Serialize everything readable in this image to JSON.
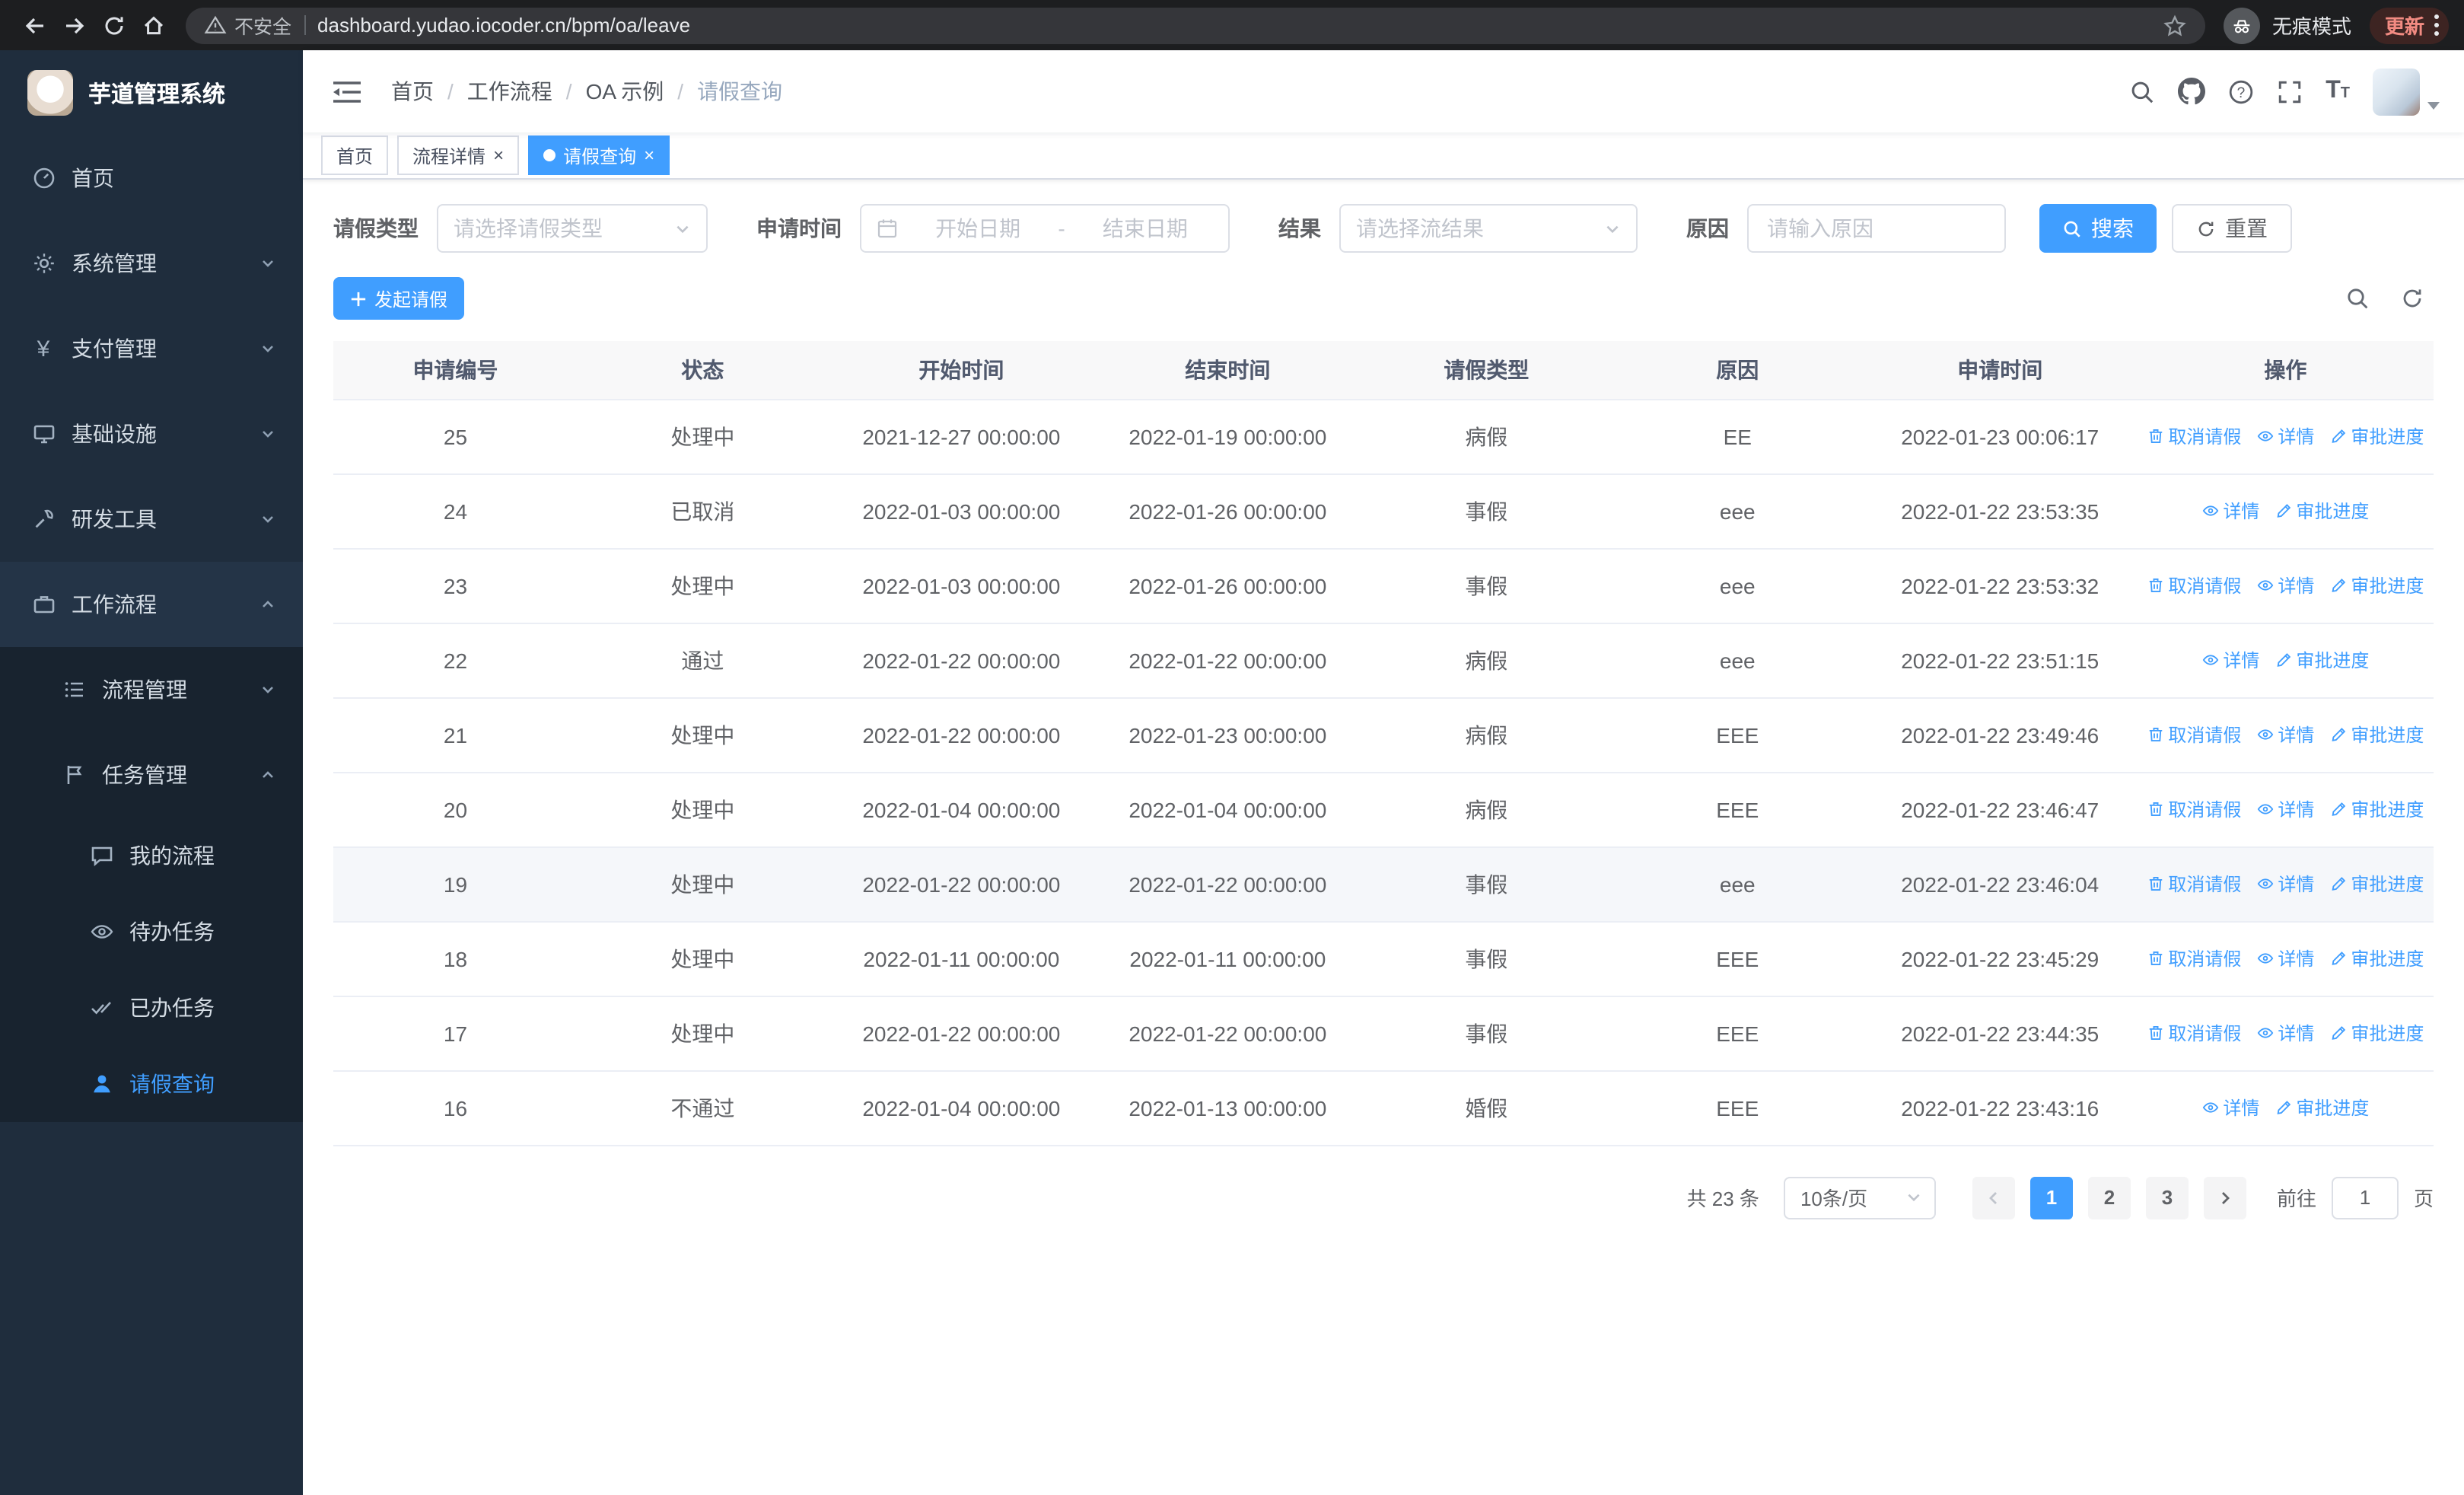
{
  "browser": {
    "security": "不安全",
    "url": "dashboard.yudao.iocoder.cn/bpm/oa/leave",
    "incognito": "无痕模式",
    "update": "更新"
  },
  "icons": {
    "yen": "¥",
    "close": "×",
    "question": "?",
    "t_big": "T",
    "t_small": "T"
  },
  "sidebar": {
    "title": "芋道管理系统",
    "menu": [
      {
        "label": "首页"
      },
      {
        "label": "系统管理"
      },
      {
        "label": "支付管理"
      },
      {
        "label": "基础设施"
      },
      {
        "label": "研发工具"
      },
      {
        "label": "工作流程"
      }
    ],
    "submenu": [
      {
        "label": "流程管理"
      },
      {
        "label": "任务管理"
      }
    ],
    "tasks": [
      {
        "label": "我的流程"
      },
      {
        "label": "待办任务"
      },
      {
        "label": "已办任务"
      },
      {
        "label": "请假查询"
      }
    ]
  },
  "header": {
    "breadcrumb": [
      "首页",
      "工作流程",
      "OA 示例",
      "请假查询"
    ],
    "breadcrumb_sep": "/"
  },
  "tabs": [
    {
      "label": "首页",
      "active": false,
      "closable": false
    },
    {
      "label": "流程详情",
      "active": false,
      "closable": true
    },
    {
      "label": "请假查询",
      "active": true,
      "closable": true
    }
  ],
  "filters": {
    "leave_type_label": "请假类型",
    "leave_type_placeholder": "请选择请假类型",
    "apply_time_label": "申请时间",
    "start_date_placeholder": "开始日期",
    "range_separator": "-",
    "end_date_placeholder": "结束日期",
    "result_label": "结果",
    "result_placeholder": "请选择流结果",
    "reason_label": "原因",
    "reason_placeholder": "请输入原因",
    "search_button": "搜索",
    "reset_button": "重置"
  },
  "toolbar": {
    "create_button": "发起请假"
  },
  "table": {
    "columns": [
      "申请编号",
      "状态",
      "开始时间",
      "结束时间",
      "请假类型",
      "原因",
      "申请时间",
      "操作"
    ],
    "op_labels": {
      "cancel": "取消请假",
      "detail": "详情",
      "progress": "审批进度"
    },
    "rows": [
      {
        "id": "25",
        "status": "处理中",
        "start": "2021-12-27 00:00:00",
        "end": "2022-01-19 00:00:00",
        "type": "病假",
        "reason": "EE",
        "applied": "2022-01-23 00:06:17",
        "ops": [
          "cancel",
          "detail",
          "progress"
        ],
        "hover": false
      },
      {
        "id": "24",
        "status": "已取消",
        "start": "2022-01-03 00:00:00",
        "end": "2022-01-26 00:00:00",
        "type": "事假",
        "reason": "eee",
        "applied": "2022-01-22 23:53:35",
        "ops": [
          "detail",
          "progress"
        ],
        "hover": false
      },
      {
        "id": "23",
        "status": "处理中",
        "start": "2022-01-03 00:00:00",
        "end": "2022-01-26 00:00:00",
        "type": "事假",
        "reason": "eee",
        "applied": "2022-01-22 23:53:32",
        "ops": [
          "cancel",
          "detail",
          "progress"
        ],
        "hover": false
      },
      {
        "id": "22",
        "status": "通过",
        "start": "2022-01-22 00:00:00",
        "end": "2022-01-22 00:00:00",
        "type": "病假",
        "reason": "eee",
        "applied": "2022-01-22 23:51:15",
        "ops": [
          "detail",
          "progress"
        ],
        "hover": false
      },
      {
        "id": "21",
        "status": "处理中",
        "start": "2022-01-22 00:00:00",
        "end": "2022-01-23 00:00:00",
        "type": "病假",
        "reason": "EEE",
        "applied": "2022-01-22 23:49:46",
        "ops": [
          "cancel",
          "detail",
          "progress"
        ],
        "hover": false
      },
      {
        "id": "20",
        "status": "处理中",
        "start": "2022-01-04 00:00:00",
        "end": "2022-01-04 00:00:00",
        "type": "病假",
        "reason": "EEE",
        "applied": "2022-01-22 23:46:47",
        "ops": [
          "cancel",
          "detail",
          "progress"
        ],
        "hover": false
      },
      {
        "id": "19",
        "status": "处理中",
        "start": "2022-01-22 00:00:00",
        "end": "2022-01-22 00:00:00",
        "type": "事假",
        "reason": "eee",
        "applied": "2022-01-22 23:46:04",
        "ops": [
          "cancel",
          "detail",
          "progress"
        ],
        "hover": true
      },
      {
        "id": "18",
        "status": "处理中",
        "start": "2022-01-11 00:00:00",
        "end": "2022-01-11 00:00:00",
        "type": "事假",
        "reason": "EEE",
        "applied": "2022-01-22 23:45:29",
        "ops": [
          "cancel",
          "detail",
          "progress"
        ],
        "hover": false
      },
      {
        "id": "17",
        "status": "处理中",
        "start": "2022-01-22 00:00:00",
        "end": "2022-01-22 00:00:00",
        "type": "事假",
        "reason": "EEE",
        "applied": "2022-01-22 23:44:35",
        "ops": [
          "cancel",
          "detail",
          "progress"
        ],
        "hover": false
      },
      {
        "id": "16",
        "status": "不通过",
        "start": "2022-01-04 00:00:00",
        "end": "2022-01-13 00:00:00",
        "type": "婚假",
        "reason": "EEE",
        "applied": "2022-01-22 23:43:16",
        "ops": [
          "detail",
          "progress"
        ],
        "hover": false
      }
    ]
  },
  "pagination": {
    "total": "共 23 条",
    "page_size": "10条/页",
    "pages": [
      "1",
      "2",
      "3"
    ],
    "active_page": "1",
    "goto_label": "前往",
    "goto_value": "1",
    "page_label": "页"
  },
  "colors": {
    "primary": "#409eff",
    "sidebar_bg": "#1f2d3d",
    "table_header_bg": "#f8f8f9",
    "update_pill_text": "#f28b82"
  }
}
